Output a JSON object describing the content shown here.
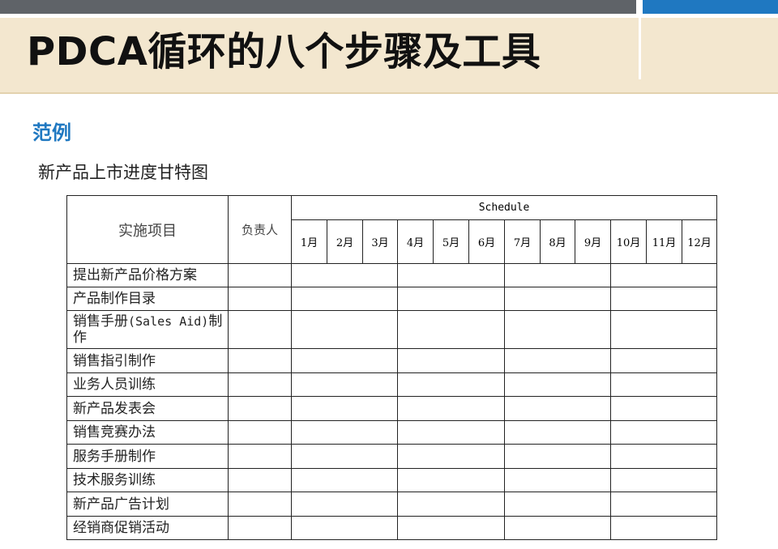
{
  "header": {
    "title": "PDCA循环的八个步骤及工具",
    "section_label": "范例",
    "subtitle": "新产品上市进度甘特图"
  },
  "table": {
    "col_item": "实施项目",
    "col_owner": "负责人",
    "col_schedule": "Schedule",
    "months": [
      "1月",
      "2月",
      "3月",
      "4月",
      "5月",
      "6月",
      "7月",
      "8月",
      "9月",
      "10月",
      "11月",
      "12月"
    ],
    "rows": [
      "提出新产品价格方案",
      "产品制作目录",
      "销售手册(Sales Aid)制作",
      "销售指引制作",
      "业务人员训练",
      "新产品发表会",
      "销售竞赛办法",
      "服务手册制作",
      "技术服务训练",
      "新产品广告计划",
      "经销商促销活动"
    ]
  },
  "colors": {
    "accent_blue": "#1f78c1",
    "top_bar_gray": "#5f6368",
    "title_band": "#f3e7cf"
  }
}
